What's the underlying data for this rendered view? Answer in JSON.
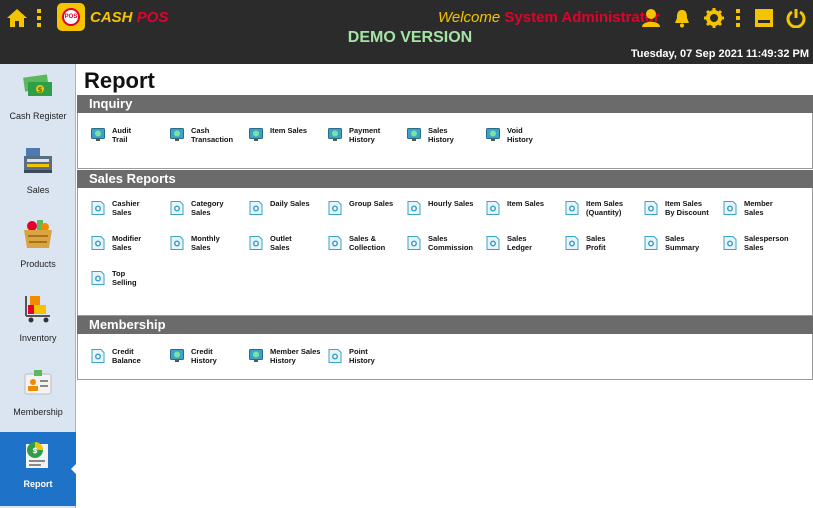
{
  "header": {
    "brand_cash": "CASH",
    "brand_pos": "POS",
    "logo_text": "POS",
    "welcome": "Welcome",
    "user": "System Administrator",
    "demo": "DEMO VERSION",
    "datetime": "Tuesday, 07 Sep 2021 11:49:32 PM",
    "icons": [
      "home-icon",
      "menu-dots-icon",
      "user-icon",
      "bell-icon",
      "gear-icon",
      "menu-dots-icon",
      "minimize-icon",
      "power-icon"
    ]
  },
  "sidebar": {
    "items": [
      {
        "label": "Cash Register",
        "icon": "cash-register-icon"
      },
      {
        "label": "Sales",
        "icon": "sales-register-icon"
      },
      {
        "label": "Products",
        "icon": "products-basket-icon"
      },
      {
        "label": "Inventory",
        "icon": "inventory-cart-icon"
      },
      {
        "label": "Membership",
        "icon": "membership-card-icon"
      },
      {
        "label": "Report",
        "icon": "report-icon",
        "active": true
      }
    ]
  },
  "main": {
    "title": "Report",
    "sections": [
      {
        "title": "Inquiry",
        "icon": "monitor-report-icon",
        "items": [
          "Audit\nTrail",
          "Cash\nTransaction",
          "Item Sales",
          "Payment\nHistory",
          "Sales\nHistory",
          "Void\nHistory"
        ]
      },
      {
        "title": "Sales Reports",
        "icon": "document-report-icon",
        "items": [
          "Cashier\nSales",
          "Category\nSales",
          "Daily Sales",
          "Group Sales",
          "Hourly Sales",
          "Item Sales",
          "Item Sales\n(Quantity)",
          "Item Sales\nBy Discount",
          "Member\nSales",
          "Modifier\nSales",
          "Monthly\nSales",
          "Outlet\nSales",
          "Sales &\nCollection",
          "Sales\nCommission",
          "Sales\nLedger",
          "Sales\nProfit",
          "Sales\nSummary",
          "Salesperson\nSales",
          "Top\nSelling"
        ]
      },
      {
        "title": "Membership",
        "items": [
          "Credit\nBalance",
          "Credit\nHistory",
          "Member Sales\nHistory",
          "Point\nHistory"
        ],
        "item_icons": [
          "document-report-icon",
          "monitor-report-icon",
          "monitor-report-icon",
          "document-report-icon"
        ]
      }
    ]
  },
  "colors": {
    "topbar": "#2b2b2b",
    "accent_yellow": "#f5c400",
    "accent_red": "#e4002b",
    "demo_green": "#a6e3a6",
    "sidebar_bg": "#dbe5f1",
    "active_blue": "#1e73c8",
    "section_header": "#6b6b6b"
  }
}
